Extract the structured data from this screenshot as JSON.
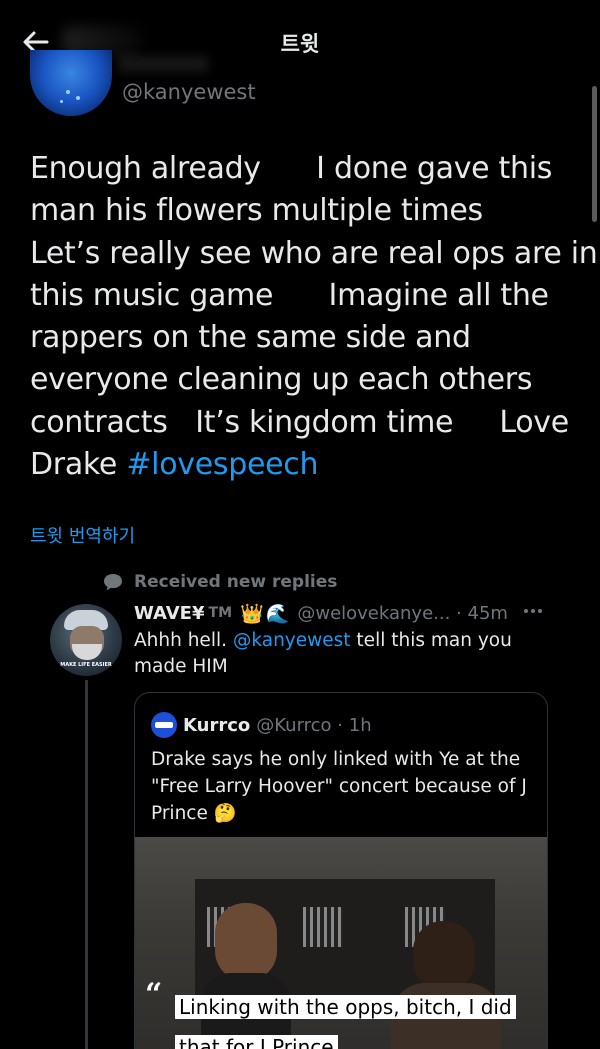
{
  "header": {
    "title": "트윗"
  },
  "main_tweet": {
    "handle": "@kanyewest",
    "text_lines": [
      "Enough already      I done gave this",
      "man his flowers multiple times",
      "Let’s really see who are real ops are in",
      "this music game      Imagine all the",
      "rappers on the same side and",
      "everyone cleaning up each others",
      "contracts   It’s kingdom time     Love"
    ],
    "last_line_text": "Drake ",
    "hashtag": "#lovespeech",
    "translate_label": "트윗 번역하기"
  },
  "replies_meta": {
    "label": "Received new replies"
  },
  "reply": {
    "name": "WAVE¥",
    "tm": "TM",
    "crown_emoji": "👑",
    "wave_emoji": "🌊",
    "handle": "@welovekanye...",
    "separator": " · ",
    "time": "45m",
    "avatar_caption": "MAKE LIFE EASIER",
    "text_before": "Ahhh hell. ",
    "mention": "@kanyewest",
    "text_after": " tell this man you made HIM"
  },
  "quote": {
    "name": "Kurrco",
    "handle": "@Kurrco",
    "separator": " · ",
    "time": "1h",
    "text": "Drake says he only linked with Ye at the \"Free Larry Hoover\" concert because of J Prince 🤔",
    "image_quote_mark": "“",
    "image_caption": "Linking with the opps, bitch, I did that for J Prince"
  },
  "colors": {
    "background": "#000000",
    "text": "#e7e9ea",
    "secondary": "#71767b",
    "link": "#1d9bf0",
    "border": "#2f3336"
  }
}
